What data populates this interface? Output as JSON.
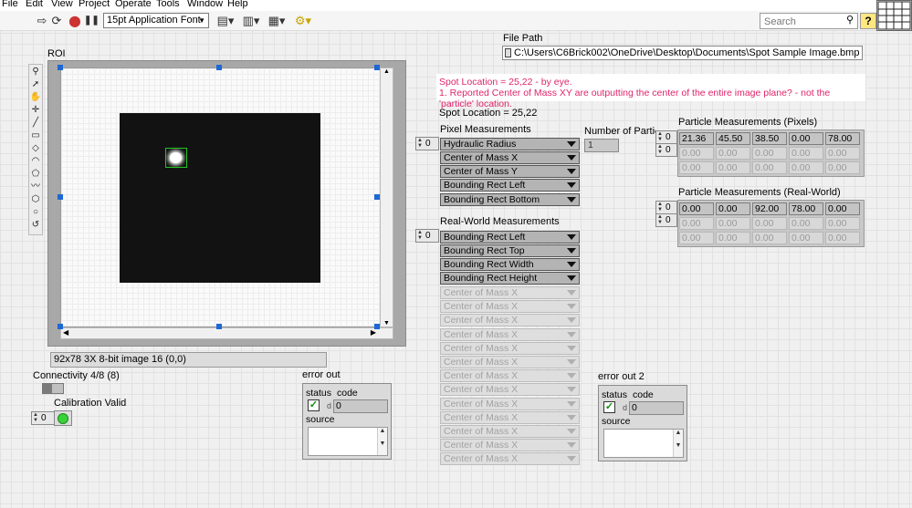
{
  "menu": [
    "File",
    "Edit",
    "View",
    "Project",
    "Operate",
    "Tools",
    "Window",
    "Help"
  ],
  "toolbar": {
    "font_select": "15pt Application Font",
    "search_placeholder": "Search",
    "help_label": "?"
  },
  "file_path": {
    "label": "File Path",
    "value": "C:\\Users\\C6Brick002\\OneDrive\\Desktop\\Documents\\Spot Sample Image.bmp"
  },
  "notes": {
    "line1": "Spot Location = 25,22 - by eye.",
    "line2": "1. Reported Center of Mass XY are outputting the center of the entire image plane? - not the 'particle' location."
  },
  "spot_location_label": "Spot Location = 25,22",
  "roi": {
    "label": "ROI",
    "image_info": "92x78 3X 8-bit image 16    (0,0)"
  },
  "connectivity_label": "Connectivity 4/8 (8)",
  "calibration": {
    "label": "Calibration Valid",
    "index": "0",
    "led_color": "#39d339"
  },
  "pixel_measurements": {
    "label": "Pixel Measurements",
    "index": "0",
    "items": [
      "Hydraulic Radius",
      "Center of Mass X",
      "Center of Mass Y",
      "Bounding Rect Left",
      "Bounding Rect Bottom"
    ]
  },
  "num_particles": {
    "label": "Number of Particles",
    "value": "1"
  },
  "particle_pixels": {
    "label": "Particle Measurements (Pixels)",
    "index_row": "0",
    "index_col": "0",
    "rows": [
      [
        "21.36",
        "45.50",
        "38.50",
        "0.00",
        "78.00"
      ],
      [
        "0.00",
        "0.00",
        "0.00",
        "0.00",
        "0.00"
      ],
      [
        "0.00",
        "0.00",
        "0.00",
        "0.00",
        "0.00"
      ]
    ]
  },
  "particle_real": {
    "label": "Particle Measurements (Real-World)",
    "index_row": "0",
    "index_col": "0",
    "rows": [
      [
        "0.00",
        "0.00",
        "92.00",
        "78.00",
        "0.00"
      ],
      [
        "0.00",
        "0.00",
        "0.00",
        "0.00",
        "0.00"
      ],
      [
        "0.00",
        "0.00",
        "0.00",
        "0.00",
        "0.00"
      ]
    ]
  },
  "real_world_measurements": {
    "label": "Real-World Measurements",
    "index": "0",
    "items": [
      "Bounding Rect Left",
      "Bounding Rect Top",
      "Bounding Rect Width",
      "Bounding Rect Height"
    ],
    "disabled_item": "Center of Mass X"
  },
  "error_out": {
    "label": "error out",
    "status": "status",
    "code": "code",
    "code_value": "0",
    "source": "source",
    "check": "✓"
  },
  "error_out_2": {
    "label": "error out 2",
    "status": "status",
    "code": "code",
    "code_value": "0",
    "source": "source",
    "check": "✓"
  }
}
